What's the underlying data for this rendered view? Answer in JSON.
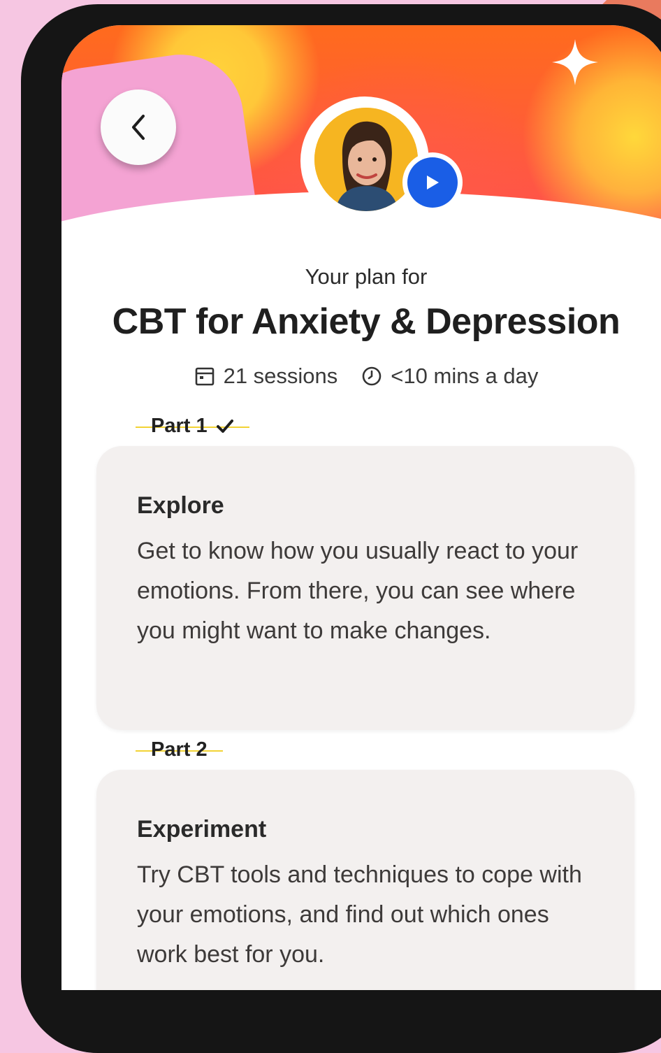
{
  "header": {
    "back_icon": "chevron-left-icon",
    "play_icon": "play-icon",
    "sparkle_icon": "sparkle-icon"
  },
  "plan": {
    "subtitle": "Your plan for",
    "title": "CBT for Anxiety & Depression",
    "sessions": "21 sessions",
    "duration": "<10 mins a day"
  },
  "parts": [
    {
      "label": "Part 1",
      "completed": true,
      "card_title": "Explore",
      "card_desc": "Get to know how you usually react to your emotions. From there, you can see where you might want to make changes."
    },
    {
      "label": "Part 2",
      "completed": false,
      "card_title": "Experiment",
      "card_desc": "Try CBT tools and techniques to cope with your emotions, and find out which ones work best for you."
    }
  ],
  "colors": {
    "accent_yellow": "#f2d335",
    "play_blue": "#1a5ee6",
    "header_orange": "#ff6b1d",
    "card_bg": "#f3f0ef"
  }
}
